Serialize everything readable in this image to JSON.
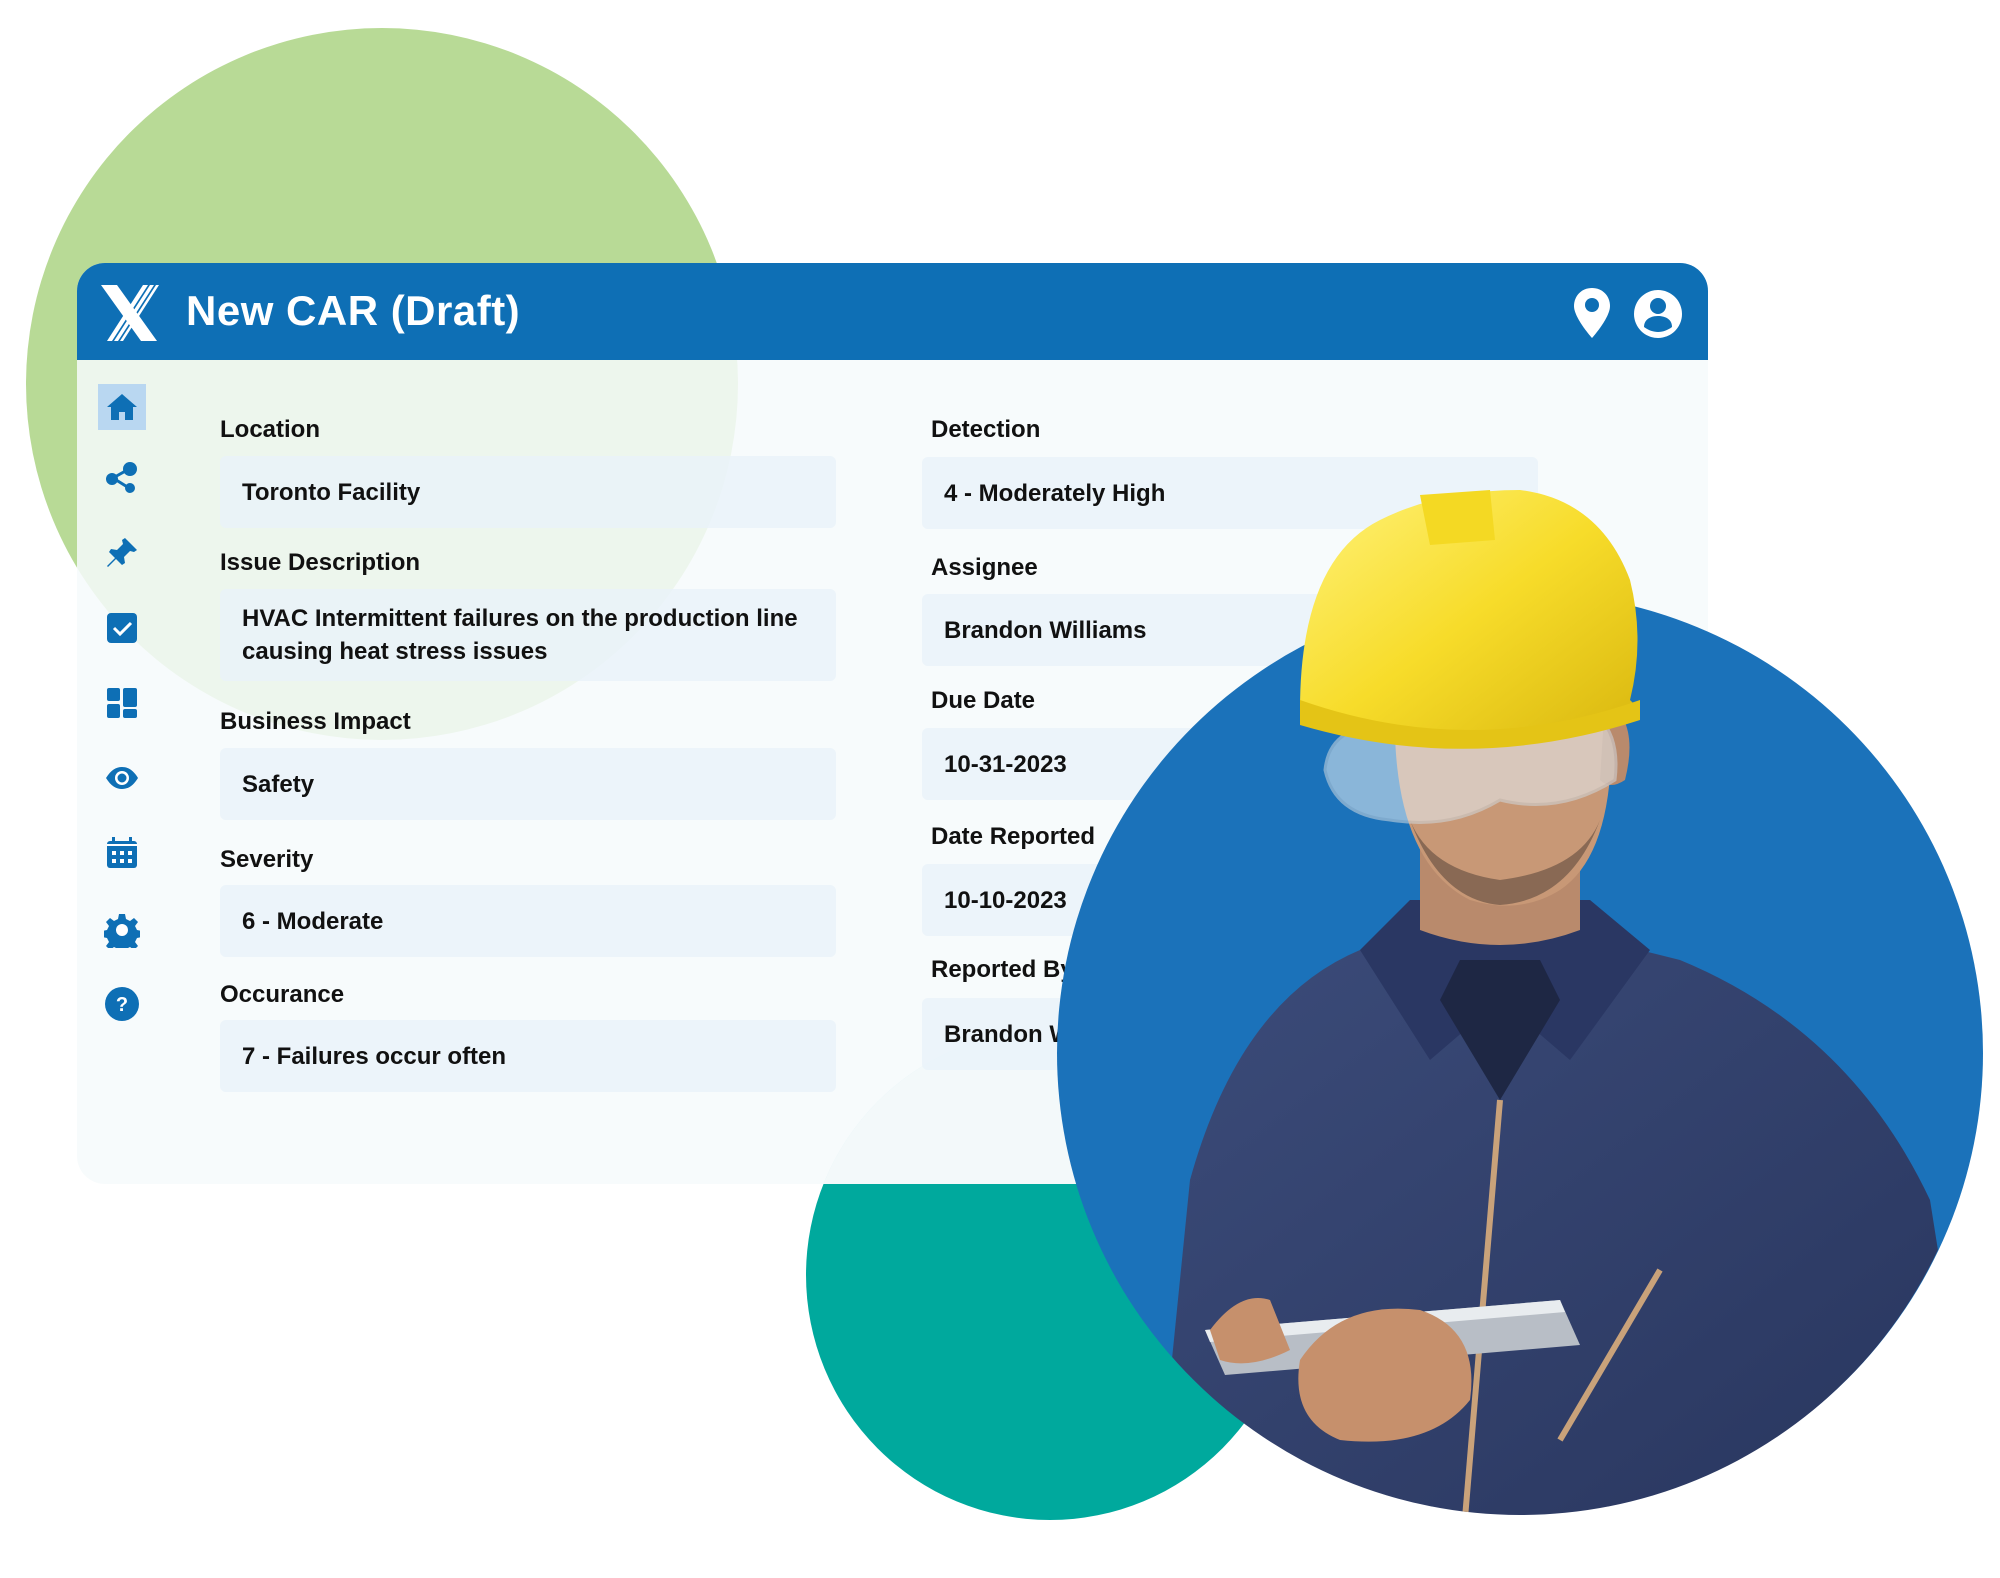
{
  "app": {
    "title": "New CAR (Draft)",
    "logo": "x-logo",
    "header_icons": [
      "location-pin-icon",
      "user-account-icon"
    ]
  },
  "sidebar": {
    "items": [
      {
        "icon": "home-icon",
        "active": true
      },
      {
        "icon": "share-icon",
        "active": false
      },
      {
        "icon": "pushpin-icon",
        "active": false
      },
      {
        "icon": "checkbox-icon",
        "active": false
      },
      {
        "icon": "dashboard-icon",
        "active": false
      },
      {
        "icon": "eye-icon",
        "active": false
      },
      {
        "icon": "calendar-icon",
        "active": false
      },
      {
        "icon": "gear-icon",
        "active": false
      },
      {
        "icon": "help-icon",
        "active": false
      }
    ]
  },
  "form": {
    "left": [
      {
        "label": "Location",
        "value": "Toronto Facility"
      },
      {
        "label": "Issue Description",
        "value": "HVAC Intermittent failures on the production line causing heat stress issues"
      },
      {
        "label": "Business Impact",
        "value": "Safety"
      },
      {
        "label": "Severity",
        "value": "6 - Moderate"
      },
      {
        "label": "Occurance",
        "value": "7 - Failures occur often"
      }
    ],
    "right": [
      {
        "label": "Detection",
        "value": "4 - Moderately High"
      },
      {
        "label": "Assignee",
        "value": "Brandon Williams"
      },
      {
        "label": "Due Date",
        "value": "10-31-2023"
      },
      {
        "label": "Date Reported",
        "value": "10-10-2023"
      },
      {
        "label": "Reported By",
        "value": "Brandon Williams"
      }
    ]
  },
  "colors": {
    "brand_blue": "#0E6FB5",
    "photo_circle_blue": "#1B72BA",
    "green_accent": "#B8DA96",
    "teal_accent": "#00A99D",
    "field_bg": "#EEF4FA",
    "active_nav_bg": "#B9D7F1"
  },
  "photo": {
    "subject": "worker in yellow hard hat and safety glasses using a tablet"
  }
}
